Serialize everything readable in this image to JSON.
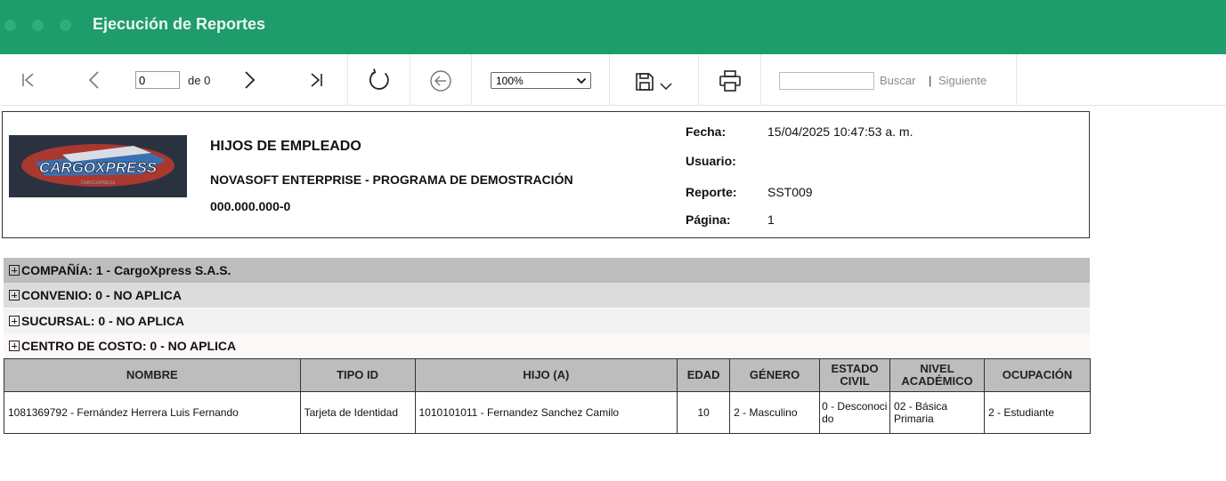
{
  "window": {
    "title": "Ejecución de Reportes"
  },
  "toolbar": {
    "page_value": "0",
    "page_of": "de 0",
    "zoom": "100%",
    "search_value": "",
    "search_label": "Buscar",
    "separator": "|",
    "next_label": "Siguiente"
  },
  "report": {
    "title": "HIJOS DE EMPLEADO",
    "company_line": "NOVASOFT ENTERPRISE - PROGRAMA DE DEMOSTRACIÓN",
    "nit": "000.000.000-0",
    "logo_text": "CARGOXPRESS",
    "logo_subtext": "CARGOXPRESS",
    "meta": [
      {
        "label": "Fecha:",
        "value": "15/04/2025 10:47:53 a. m."
      },
      {
        "label": "Usuario:",
        "value": ""
      },
      {
        "label": "Reporte:",
        "value": "SST009"
      },
      {
        "label": "Página:",
        "value": "1"
      }
    ]
  },
  "groups": [
    {
      "label": "COMPAÑÍA: 1 - CargoXpress S.A.S.",
      "color": "#bdbdbd"
    },
    {
      "label": "CONVENIO: 0 - NO APLICA",
      "color": "#dcdcdc"
    },
    {
      "label": "SUCURSAL: 0 - NO APLICA",
      "color": "#f2f2f2"
    },
    {
      "label": "CENTRO DE COSTO: 0 - NO APLICA",
      "color": "#fdf8f8"
    }
  ],
  "table": {
    "headers": [
      "NOMBRE",
      "TIPO ID",
      "HIJO (A)",
      "EDAD",
      "GÉNERO",
      "ESTADO CIVIL",
      "NIVEL ACADÉMICO",
      "OCUPACIÓN"
    ],
    "rows": [
      [
        "1081369792 - Fernández Herrera Luis Fernando",
        "Tarjeta de Identidad",
        "1010101011 - Fernandez Sanchez Camilo",
        "10",
        "2 - Masculino",
        "0 - Desconocido",
        "02 - Básica Primaria",
        "2 - Estudiante"
      ]
    ]
  },
  "colors": {
    "titlebar": "#1f9c6b",
    "header_gray": "#bdbdbd"
  }
}
